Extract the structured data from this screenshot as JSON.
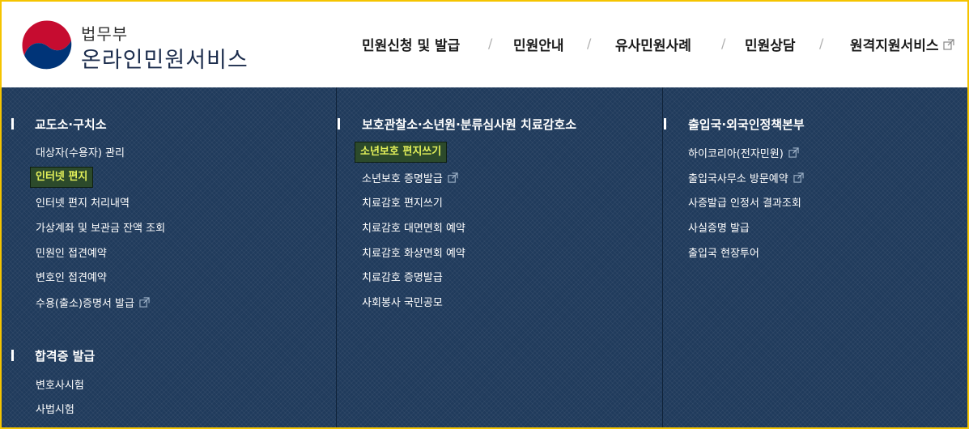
{
  "brand": {
    "ministry": "법무부",
    "service": "온라인민원서비스"
  },
  "nav": {
    "items": [
      {
        "label": "민원신청 및 발급"
      },
      {
        "label": "민원안내"
      },
      {
        "label": "유사민원사례"
      },
      {
        "label": "민원상담"
      },
      {
        "label": "원격지원서비스",
        "external": true
      }
    ],
    "separator": "/"
  },
  "menu": {
    "col1": {
      "sections": [
        {
          "title": "교도소·구치소",
          "links": [
            {
              "label": "대상자(수용자) 관리"
            },
            {
              "label": "인터넷 편지",
              "active": true
            },
            {
              "label": "인터넷 편지 처리내역"
            },
            {
              "label": "가상계좌 및 보관금 잔액 조회"
            },
            {
              "label": "민원인 접견예약"
            },
            {
              "label": "변호인 접견예약"
            },
            {
              "label": "수용(출소)증명서 발급",
              "external": true
            }
          ]
        },
        {
          "title": "합격증 발급",
          "links": [
            {
              "label": "변호사시험"
            },
            {
              "label": "사법시험"
            }
          ]
        }
      ]
    },
    "col2": {
      "title": "보호관찰소·소년원·분류심사원 치료감호소",
      "links": [
        {
          "label": "소년보호 편지쓰기",
          "active": true
        },
        {
          "label": "소년보호 증명발급",
          "external": true
        },
        {
          "label": "치료감호 편지쓰기"
        },
        {
          "label": "치료감호 대면면회 예약"
        },
        {
          "label": "치료감호 화상면회 예약"
        },
        {
          "label": "치료감호 증명발급"
        },
        {
          "label": "사회봉사 국민공모"
        }
      ]
    },
    "col3": {
      "title": "출입국·외국인정책본부",
      "links": [
        {
          "label": "하이코리아(전자민원)",
          "external": true
        },
        {
          "label": "출입국사무소 방문예약",
          "external": true
        },
        {
          "label": "사증발급 인정서 결과조회"
        },
        {
          "label": "사실증명 발급"
        },
        {
          "label": "출입국 현장투어"
        }
      ]
    }
  },
  "colors": {
    "panel_bg": "#203b5c",
    "active_bg": "#2c4a2b",
    "active_text": "#e5f25a",
    "frame": "#f5c400"
  }
}
